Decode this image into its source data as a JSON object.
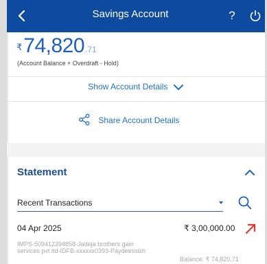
{
  "header": {
    "title": "Savings Account",
    "help_label": "?"
  },
  "balance": {
    "currency_symbol": "₹",
    "integer_part": "74,820",
    "decimal_part": ".71",
    "note": "(Account Balance + Overdraft - Hold)"
  },
  "account_actions": {
    "show_details_label": "Show Account Details",
    "share_details_label": "Share Account Details"
  },
  "statement": {
    "title": "Statement",
    "filter_value": "Recent Transactions",
    "transactions": [
      {
        "date": "04 Apr 2025",
        "amount": "₹ 3,00,000.00",
        "description": "IMPS-509412394858-Jadeja brothers gain services pvt ltd-IDFB-xxxxxx0393-Paydeessish",
        "balance": "Balance: ₹ 74,820.71"
      }
    ]
  },
  "colors": {
    "header_bg": "#0d4aa0",
    "accent": "#1f5fbd",
    "link": "#1f6fd1",
    "debit_arrow": "#e0392b"
  }
}
